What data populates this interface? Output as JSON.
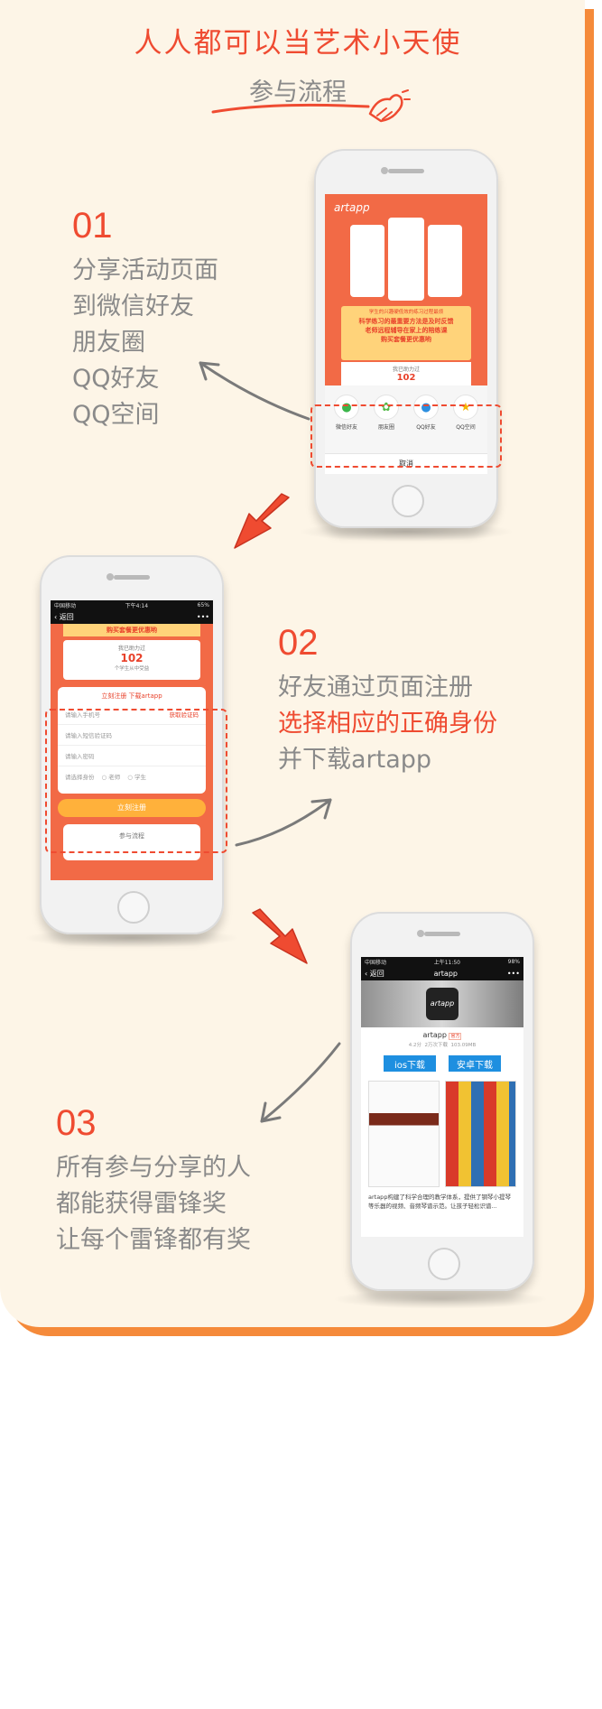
{
  "header": {
    "title": "人人都可以当艺术小天使",
    "subtitle": "参与流程"
  },
  "steps": [
    {
      "num": "01",
      "lines": [
        "分享活动页面",
        "到微信好友",
        "朋友圈",
        "QQ好友",
        "QQ空间"
      ]
    },
    {
      "num": "02",
      "lines": [
        "好友通过页面注册",
        "选择相应的正确身份",
        "并下载artapp"
      ]
    },
    {
      "num": "03",
      "lines": [
        "所有参与分享的人",
        "都能获得雷锋奖",
        "让每个雷锋都有奖"
      ]
    }
  ],
  "phone1": {
    "logo": "artapp",
    "slogan_small": "学生的兴趣硬低效的练习过程最烦",
    "slogan_1": "科学练习的最重要方法是及时反馈",
    "slogan_2": "老师远程辅导在家上的陪练课",
    "slogan_3": "购买套餐更优惠哟",
    "help_label": "我已助力过",
    "help_count": "102",
    "share": [
      {
        "icon": "wechat-icon",
        "label": "微信好友",
        "color": "#3bb54a"
      },
      {
        "icon": "moments-icon",
        "label": "朋友圈",
        "color": "#53b947"
      },
      {
        "icon": "qq-icon",
        "label": "QQ好友",
        "color": "#2d8fe0"
      },
      {
        "icon": "qzone-icon",
        "label": "QQ空间",
        "color": "#f4b400"
      }
    ],
    "cancel": "取消"
  },
  "phone2": {
    "carrier": "中国移动",
    "time": "下午4:14",
    "battery": "65%",
    "back": "返回",
    "more": "•••",
    "banner": "购买套餐更优惠哟",
    "help_label": "我已助力过",
    "help_count": "102",
    "help_sub": "个学生从中受益",
    "form_title": "立刻注册  下载artapp",
    "phone_placeholder": "请输入手机号",
    "get_code": "获取验证码",
    "code_placeholder": "请输入短信验证码",
    "password_placeholder": "请输入密码",
    "identity_label": "请选择身份",
    "identity_teacher": "老师",
    "identity_student": "学生",
    "register_button": "立刻注册",
    "process_label": "参与流程"
  },
  "phone3": {
    "carrier": "中国移动",
    "time": "上午11:50",
    "battery": "98%",
    "back": "返回",
    "nav_title": "artapp",
    "more": "•••",
    "app_name": "artapp",
    "app_tag": "官方",
    "rating": "4.2分",
    "downloads": "2万次下载",
    "size": "103.09MB",
    "ios_button": "ios下载",
    "android_button": "安卓下载",
    "description": "artapp构建了科学合理的教学体系，提供了钢琴小提琴等乐器的视频、音频琴谱示范。让孩子轻松识谱..."
  },
  "colors": {
    "accent": "#ef4b31",
    "card_bg": "#fdf5e7",
    "card_shadow": "#f58a3a",
    "text_gray": "#8a8a8a",
    "button_blue": "#1e8fe0"
  }
}
